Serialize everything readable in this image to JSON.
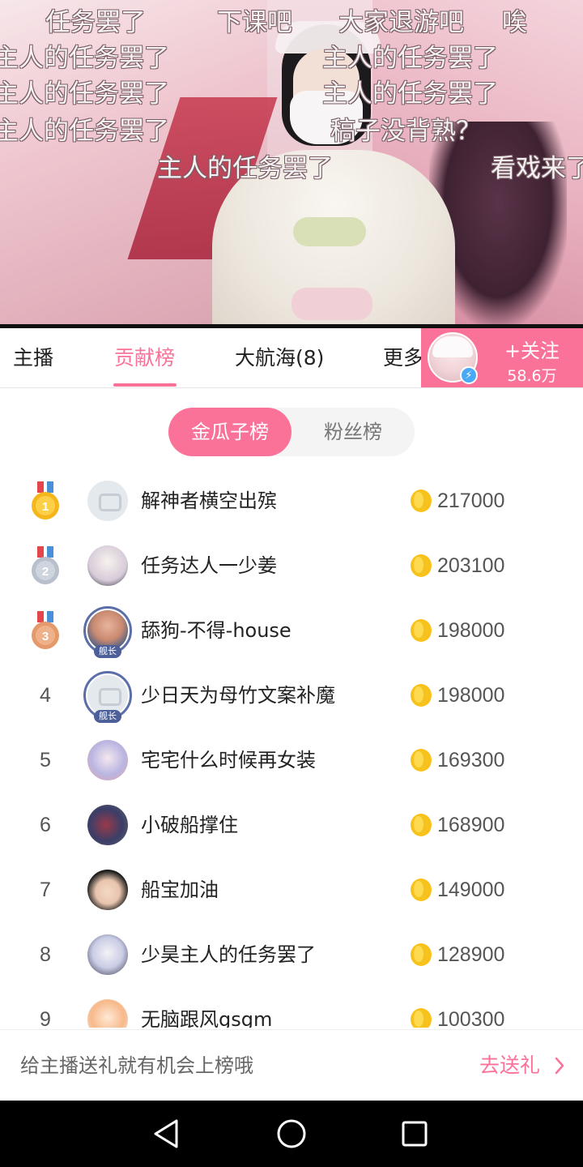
{
  "danmaku": [
    "任务罢了",
    "下课吧",
    "大家退游吧",
    "唉",
    "主人的任务罢了",
    "主人的任务罢了",
    "主人的任务罢了",
    "主人的任务罢了",
    "主人的任务罢了",
    "稿子没背熟？",
    "主人的任务罢了",
    "看戏来了"
  ],
  "tabs": {
    "anchor": "主播",
    "contribution": "贡献榜",
    "voyage": "大航海(8)",
    "more": "更多"
  },
  "follow": {
    "label": "+关注",
    "count": "58.6万"
  },
  "ranking_toggle": {
    "gold_seeds": "金瓜子榜",
    "fans": "粉丝榜"
  },
  "colors": {
    "accent": "#fb7299",
    "medal_gold": "#f5b61c",
    "medal_silver": "#b8c0cc",
    "medal_bronze": "#e59a6c",
    "coin": "#f7c21c",
    "guard_blue": "#4d5f98"
  },
  "guard_tag": "舰长",
  "ranking": [
    {
      "rank": "1",
      "name": "解神者横空出殡",
      "score": "217000",
      "medal": "gold-medal-icon",
      "medal_number": "1"
    },
    {
      "rank": "2",
      "name": "任务达人一少姜",
      "score": "203100",
      "medal": "silver-medal-icon",
      "medal_number": "2"
    },
    {
      "rank": "3",
      "name": "舔狗-不得-house",
      "score": "198000",
      "medal": "bronze-medal-icon",
      "medal_number": "3"
    },
    {
      "rank": "4",
      "name": "少日天为母竹文案补魔",
      "score": "198000"
    },
    {
      "rank": "5",
      "name": "宅宅什么时候再女装",
      "score": "169300"
    },
    {
      "rank": "6",
      "name": "小破船撑住",
      "score": "168900"
    },
    {
      "rank": "7",
      "name": "船宝加油",
      "score": "149000"
    },
    {
      "rank": "8",
      "name": "少昊主人的任务罢了",
      "score": "128900"
    },
    {
      "rank": "9",
      "name": "无脑跟风gsgm",
      "score": "100300"
    }
  ],
  "bottom": {
    "hint": "给主播送礼就有机会上榜哦",
    "cta": "去送礼"
  }
}
